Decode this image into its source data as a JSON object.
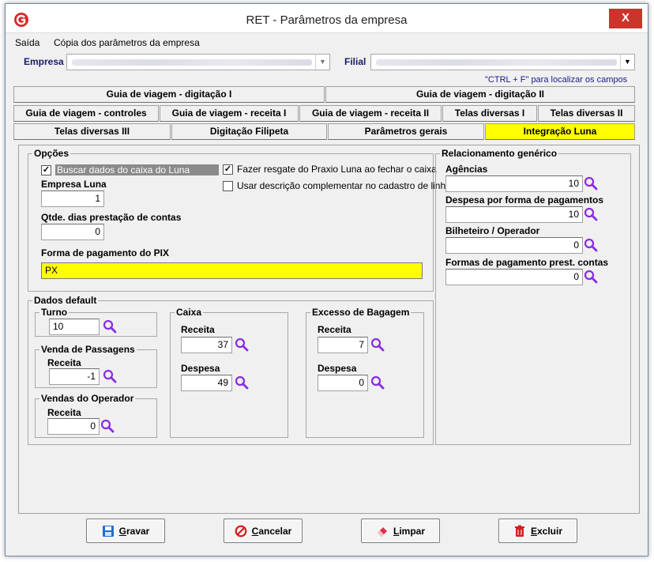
{
  "window": {
    "title": "RET - Parâmetros da empresa",
    "close_label": "X"
  },
  "menu": {
    "items": [
      "Saída",
      "Cópia dos parâmetros da empresa"
    ]
  },
  "company": {
    "empresa_label": "Empresa",
    "filial_label": "Filial"
  },
  "hint": "\"CTRL + F\" para localizar os campos",
  "tabs": {
    "row1": [
      "Guia de viagem - digitação I",
      "Guia de viagem - digitação II"
    ],
    "row2": [
      "Guia de viagem - controles",
      "Guia de viagem - receita I",
      "Guia de viagem - receita II",
      "Telas diversas I",
      "Telas diversas II"
    ],
    "row3": [
      "Telas diversas III",
      "Digitação Filipeta",
      "Parâmetros gerais",
      "Integração Luna"
    ]
  },
  "opcoes": {
    "legend": "Opções",
    "buscar_label": "Buscar dados do caixa do Luna",
    "resgate_label": "Fazer resgate do Praxio Luna ao fechar o caixa",
    "descricao_label": "Usar descrição complementar no cadastro de linha",
    "empresa_luna_label": "Empresa Luna",
    "empresa_luna_value": "1",
    "qtde_label": "Qtde. dias prestação de contas",
    "qtde_value": "0",
    "pix_label": "Forma de pagamento do PIX",
    "pix_value": "PX"
  },
  "relacionamento": {
    "legend": "Relacionamento genérico",
    "agencias_label": "Agências",
    "agencias_value": "10",
    "despesa_label": "Despesa por forma de pagamentos",
    "despesa_value": "10",
    "bilheteiro_label": "Bilheteiro / Operador",
    "bilheteiro_value": "0",
    "formas_label": "Formas de pagamento prest. contas",
    "formas_value": "0"
  },
  "default": {
    "legend": "Dados default",
    "turno_legend": "Turno",
    "turno_value": "10",
    "venda_legend": "Venda de Passagens",
    "venda_receita_label": "Receita",
    "venda_receita_value": "-1",
    "vendas_op_legend": "Vendas do Operador",
    "vendas_op_receita_label": "Receita",
    "vendas_op_receita_value": "0",
    "caixa_legend": "Caixa",
    "caixa_receita_label": "Receita",
    "caixa_receita_value": "37",
    "caixa_despesa_label": "Despesa",
    "caixa_despesa_value": "49",
    "excesso_legend": "Excesso de Bagagem",
    "excesso_receita_label": "Receita",
    "excesso_receita_value": "7",
    "excesso_despesa_label": "Despesa",
    "excesso_despesa_value": "0"
  },
  "buttons": {
    "gravar_first": "G",
    "gravar_rest": "ravar",
    "cancelar_first": "C",
    "cancelar_rest": "ancelar",
    "limpar_first": "L",
    "limpar_rest": "impar",
    "excluir_first": "E",
    "excluir_rest": "xcluir"
  },
  "colors": {
    "active_tab": "#ffff00",
    "pix_field": "#ffff00",
    "close_button": "#c9342b",
    "search_icon": "#8a2be2"
  }
}
